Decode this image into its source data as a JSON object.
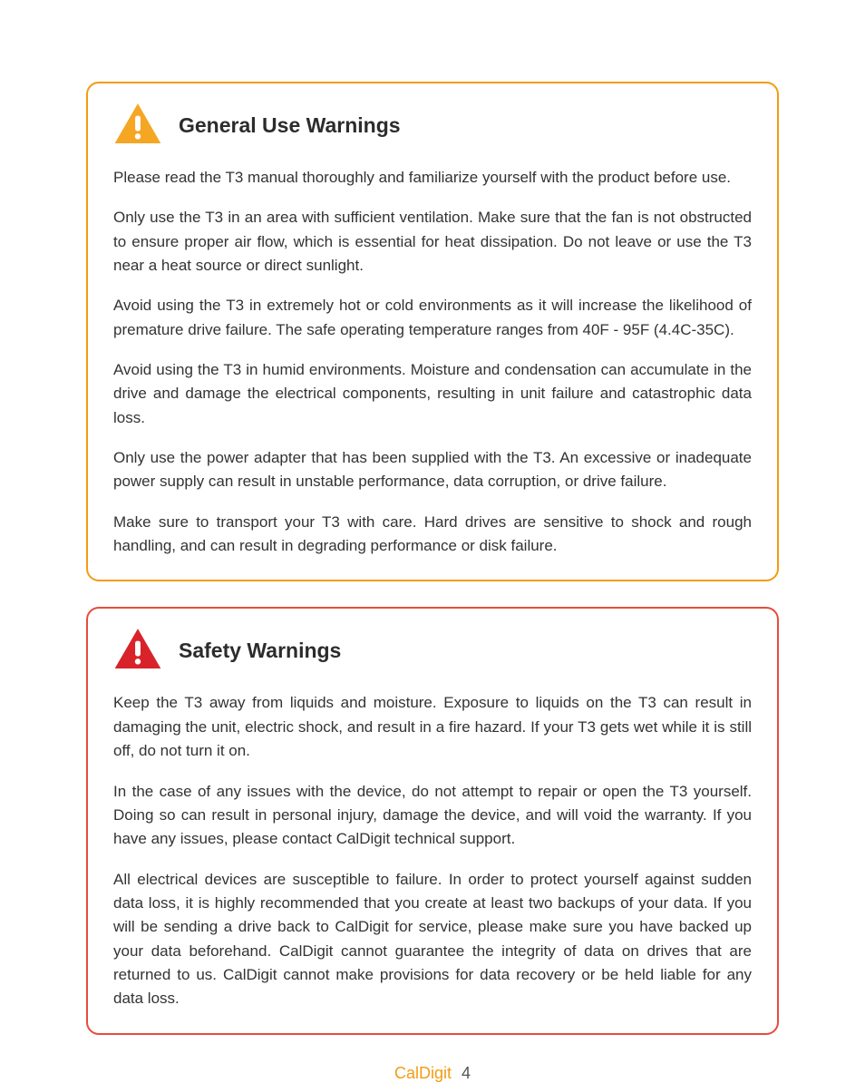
{
  "sections": [
    {
      "title": "General Use Warnings",
      "color": "orange",
      "iconFill": "#f5a623",
      "paragraphs": [
        "Please read the T3 manual thoroughly and familiarize yourself with the product before use.",
        "Only use the T3 in an area with sufficient ventilation.  Make sure that the fan is not obstructed to ensure proper air flow, which is essential for heat dissipation.  Do not leave or use the T3 near a heat source or direct sunlight.",
        "Avoid using the T3 in extremely hot or cold environments as it will increase the likelihood of premature drive failure.  The safe operating temperature ranges from 40F - 95F (4.4C-35C).",
        "Avoid using the T3 in humid environments.  Moisture and condensation can accumulate in the drive and damage the electrical components, resulting in unit failure and catastrophic data loss.",
        "Only use the power adapter that has been supplied with the T3.  An excessive or inadequate power supply can result in unstable performance, data corruption, or drive failure.",
        "Make sure to transport your T3 with care.  Hard drives are sensitive to shock and rough handling, and can result in degrading performance or disk failure."
      ]
    },
    {
      "title": "Safety Warnings",
      "color": "red",
      "iconFill": "#d8232a",
      "paragraphs": [
        "Keep the T3 away from liquids and moisture.  Exposure to liquids on the T3 can result in damaging the unit, electric shock, and result in a fire hazard.  If your T3 gets wet while it is still off, do not turn it on.",
        "In the case of any issues with the device, do not attempt to repair or open the T3 yourself.  Doing so can result in personal injury, damage the device, and will void the warranty.  If you have any issues, please contact CalDigit technical support.",
        "All electrical devices are susceptible to failure.  In order to protect yourself against sudden data loss, it is highly recommended that you create at least two backups of your data.  If you will be sending a drive back to CalDigit for service, please make sure you have backed up your data beforehand.  CalDigit cannot guarantee the integrity of data on drives that are returned to us.  CalDigit cannot make provisions for data recovery or be held liable for any data loss."
      ]
    }
  ],
  "footer": {
    "brand": "CalDigit",
    "page": "4"
  }
}
